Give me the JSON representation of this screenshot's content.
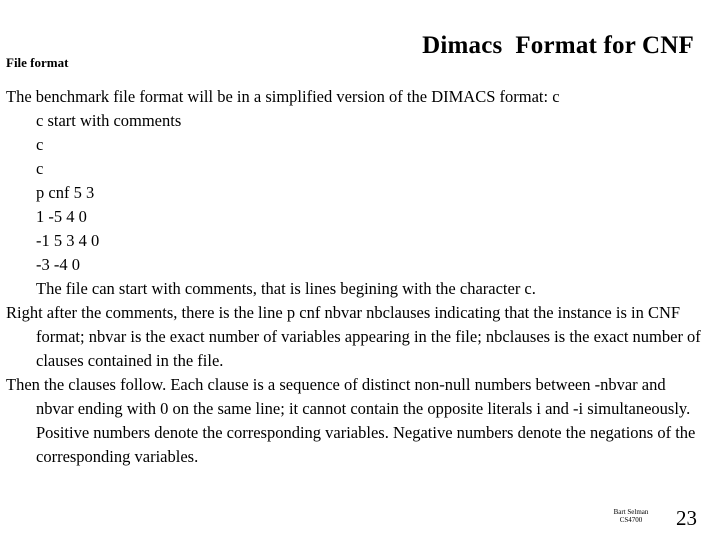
{
  "slide": {
    "title": "Dimacs  Format for CNF",
    "section_label": "File format",
    "background_color": "#ffffff",
    "text_color": "#000000"
  },
  "body": {
    "intro_paragraph": "The benchmark file format will be in a simplified version of the DIMACS format: c",
    "example_lines": [
      "c start with comments",
      "c",
      "c",
      "p cnf 5 3",
      "1 -5 4 0",
      "-1 5 3 4 0",
      "-3 -4 0"
    ],
    "comment_note": "The file can start with comments, that is lines begining with the character c.",
    "problem_line_paragraph": "Right after the comments, there is the line p cnf nbvar nbclauses indicating that the instance is in CNF format; nbvar is the exact number of variables appearing in the file; nbclauses is the exact number of clauses contained in the file.",
    "clauses_paragraph": "Then the clauses follow. Each clause is a sequence of distinct non-null numbers between -nbvar and nbvar ending with 0 on the same line; it cannot contain the opposite literals i and -i simultaneously. Positive numbers denote the corresponding variables. Negative numbers denote the negations of the corresponding variables."
  },
  "footer": {
    "author": "Bart Selman",
    "course": "CS4700",
    "page_number": "23"
  }
}
